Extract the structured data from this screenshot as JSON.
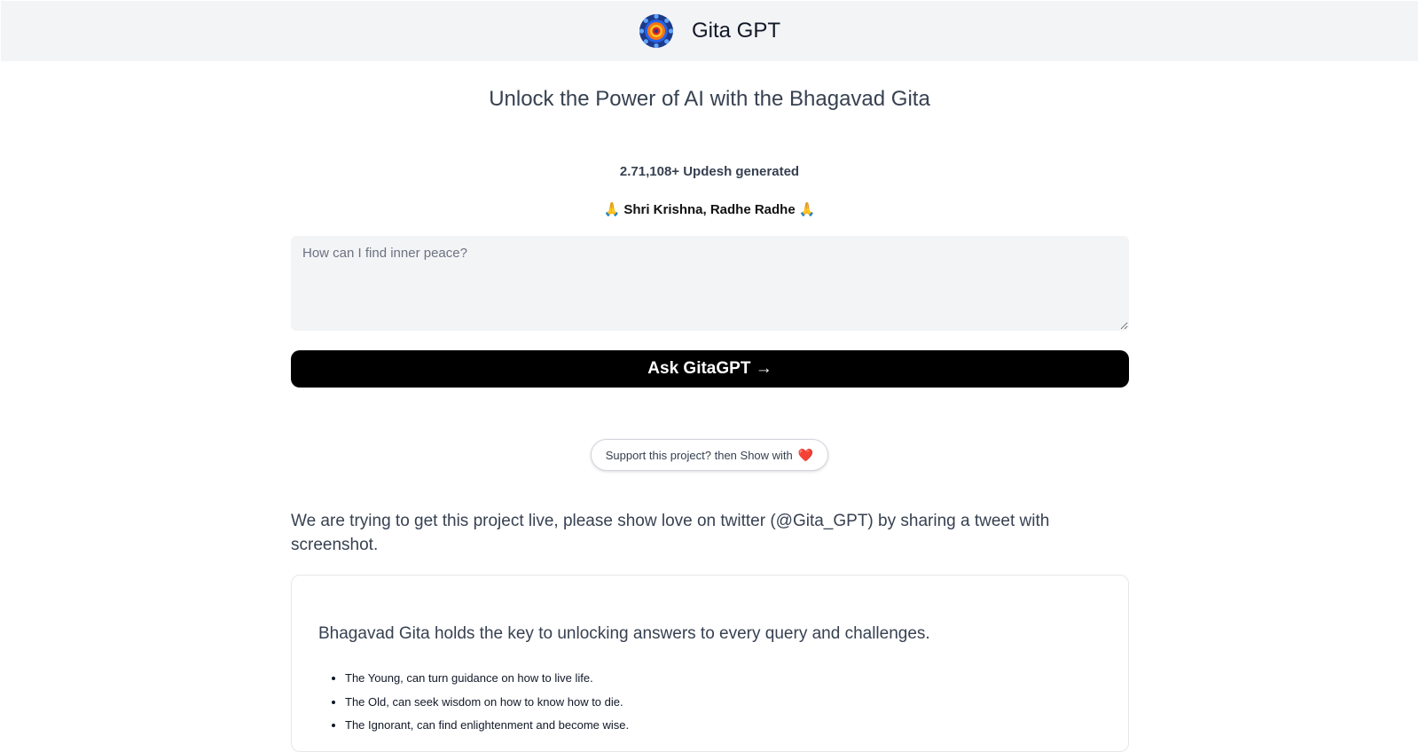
{
  "header": {
    "title": "Gita GPT",
    "logo_icon": "mandala-logo-icon"
  },
  "hero": {
    "tagline": "Unlock the Power of AI with the Bhagavad Gita",
    "counter": "2.71,108+ Updesh generated",
    "blessing": "🙏 Shri Krishna, Radhe Radhe 🙏"
  },
  "form": {
    "question_placeholder": "How can I find inner peace?",
    "question_value": "",
    "ask_label": "Ask GitaGPT →"
  },
  "support": {
    "label": "Support this project? then Show with",
    "heart": "❤️"
  },
  "appeal": "We are trying to get this project live, please show love on twitter (@Gita_GPT) by sharing a tweet with screenshot.",
  "card": {
    "heading": "Bhagavad Gita holds the key to unlocking answers to every query and challenges.",
    "items": [
      "The Young, can turn guidance on how to live life.",
      "The Old, can seek wisdom on how to know how to die.",
      "The Ignorant, can find enlightenment and become wise."
    ]
  },
  "colors": {
    "header_bg": "#f3f4f6",
    "button_bg": "#000000",
    "heart": "#dc2626"
  }
}
